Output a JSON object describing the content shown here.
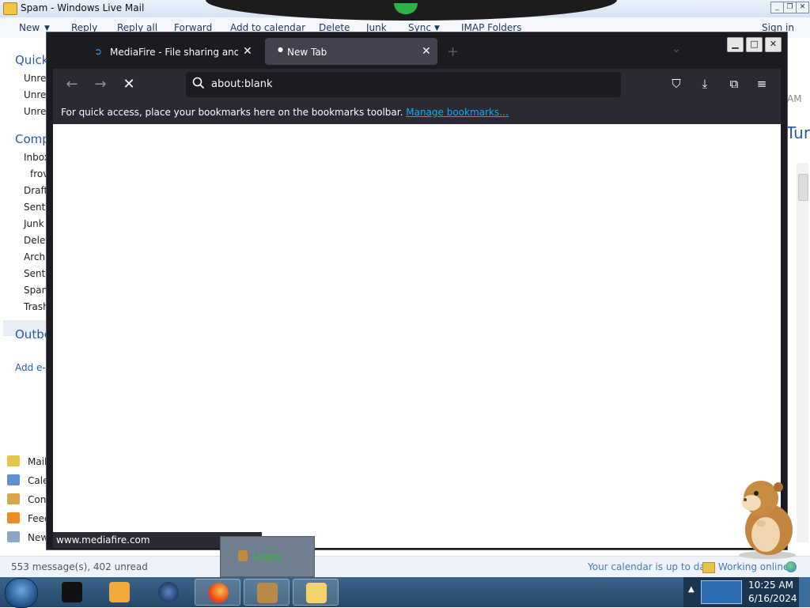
{
  "wlm": {
    "title": "Spam - Windows Live Mail",
    "toolbar": {
      "new": "New",
      "reply": "Reply",
      "reply_all": "Reply all",
      "forward": "Forward",
      "add_to_calendar": "Add to calendar",
      "delete": "Delete",
      "junk": "Junk",
      "sync": "Sync",
      "imap_folders": "IMAP Folders",
      "sign_in": "Sign in"
    },
    "nav": {
      "quick_views": "Quick",
      "quick_items": [
        "Unre",
        "Unre",
        "Unre"
      ],
      "account": "Comp",
      "folders": [
        "Inbox",
        "frov",
        "Draft",
        "Sent",
        "Junk",
        "Delet",
        "Archi",
        "Sent",
        "Spam",
        "Trash"
      ],
      "outbox": "Outbo",
      "add_email": "Add e-"
    },
    "bottom_nav": [
      "Mail",
      "Cale",
      "Con",
      "Feed",
      "New"
    ],
    "right_partial": {
      "am": "AM",
      "fragment": "Tur"
    },
    "status": {
      "messages": "553 message(s), 402 unread",
      "calendar": "Your calendar is up to date",
      "online": "Working online"
    }
  },
  "firefox": {
    "tabs": [
      {
        "label": "MediaFire - File sharing and sto",
        "close": "✕"
      },
      {
        "label": "New Tab",
        "close": "✕"
      }
    ],
    "new_tab_button": "+",
    "url": "about:blank",
    "bookmarks_message": "For quick access, place your bookmarks here on the bookmarks toolbar.",
    "bookmarks_link": "Manage bookmarks…",
    "status_url": "www.mediafire.com"
  },
  "taskbar": {
    "time": "10:25 AM",
    "date": "6/16/2024"
  },
  "logon_popup": {
    "label": "Logon"
  },
  "colors": {
    "firefox_dark": "#1c1b22",
    "firefox_toolbar": "#2b2a33",
    "link": "#00b3f4",
    "wlm_accent": "#2b5b9b"
  }
}
